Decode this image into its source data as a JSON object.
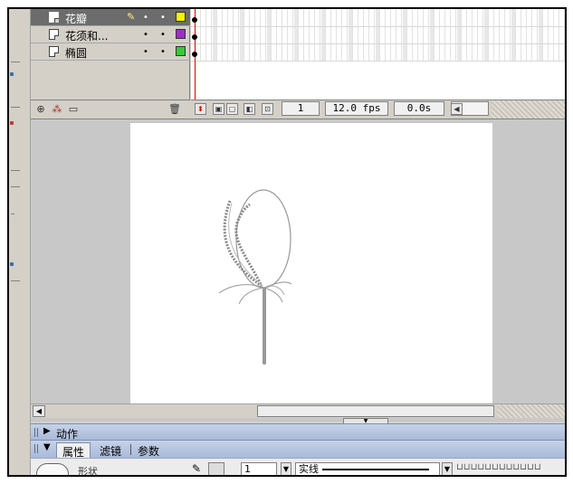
{
  "timeline": {
    "layers": [
      {
        "name": "花瓣",
        "selected": true,
        "color": "#f4f400",
        "visible_mark": "•",
        "lock_mark": "•",
        "edit_icon": "pencil-icon"
      },
      {
        "name": "花须和...",
        "selected": false,
        "color": "#9b30c8",
        "visible_mark": "•",
        "lock_mark": "•"
      },
      {
        "name": "椭圆",
        "selected": false,
        "color": "#33cc33",
        "visible_mark": "•",
        "lock_mark": "•"
      }
    ],
    "status": {
      "current_frame": "1",
      "frame_rate": "12.0 fps",
      "elapsed_time": "0.0s"
    }
  },
  "panels": {
    "actions": {
      "title": "动作"
    },
    "properties": {
      "tabs": [
        {
          "label": "属性",
          "active": true
        },
        {
          "label": "滤镜",
          "active": false
        },
        {
          "label": "参数",
          "active": false
        }
      ],
      "shape_label": "形状",
      "stroke_height": "1",
      "stroke_style": "实线"
    }
  },
  "colors": {
    "selected_layer": "#6c6c6c",
    "stage_bg": "#c8c8c8",
    "panel_header": "#b4c3df",
    "playhead": "#dd0000"
  }
}
